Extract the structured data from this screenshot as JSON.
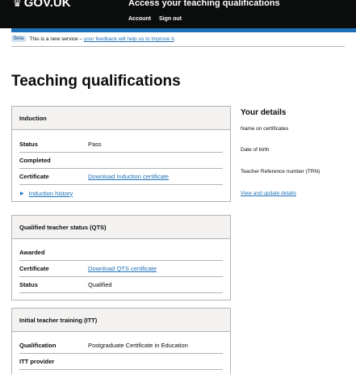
{
  "header": {
    "logo_text": "GOV.UK",
    "service_name": "Access your teaching qualifications",
    "nav": {
      "account": "Account",
      "sign_out": "Sign out"
    }
  },
  "phase_banner": {
    "tag": "Beta",
    "text": "This is a new service –",
    "link": "your feedback will help us to improve it",
    "suffix": "."
  },
  "page_title": "Teaching qualifications",
  "induction": {
    "heading": "Induction",
    "rows": [
      {
        "key": "Status",
        "value": "Pass"
      },
      {
        "key": "Completed",
        "value": ""
      },
      {
        "key": "Certificate",
        "link": "Download Induction certificate"
      }
    ],
    "history_link": "Induction history"
  },
  "qts": {
    "heading": "Qualified teacher status (QTS)",
    "rows": [
      {
        "key": "Awarded",
        "value": ""
      },
      {
        "key": "Certificate",
        "link": "Download QTS certificate"
      },
      {
        "key": "Status",
        "value": "Qualified"
      }
    ]
  },
  "itt": {
    "heading": "Initial teacher training (ITT)",
    "rows": [
      {
        "key": "Qualification",
        "value": "Postgraduate Certificate in Education"
      },
      {
        "key": "ITT provider",
        "value": ""
      }
    ]
  },
  "your_details": {
    "title": "Your details",
    "items": [
      "Name on certificates",
      "Date of birth",
      "Teacher Reference number (TRN)"
    ],
    "link": "View and update details"
  },
  "colors": {
    "header": "#0b0c0c",
    "brand_blue": "#1d70b8",
    "link": "#1d70b8",
    "card_head": "#f3f2f1"
  }
}
